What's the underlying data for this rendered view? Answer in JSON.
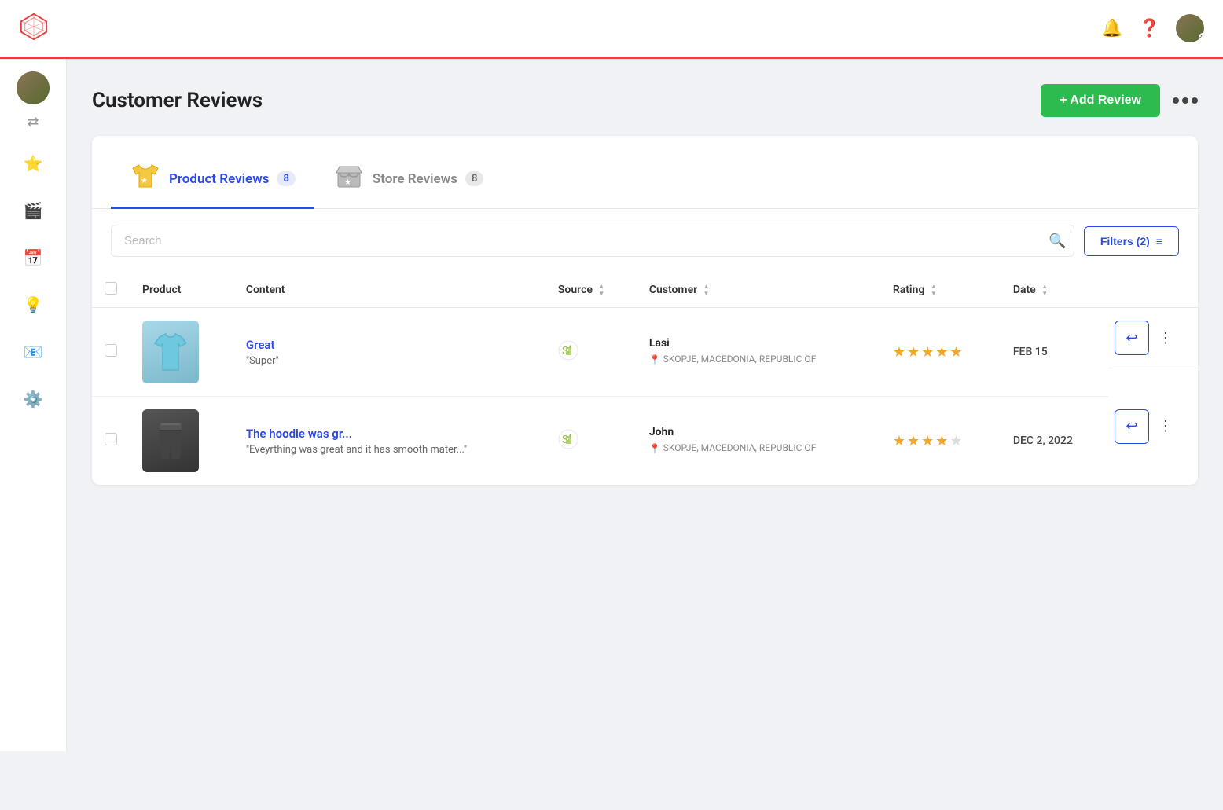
{
  "topnav": {
    "logo_alt": "App Logo"
  },
  "page": {
    "title": "Customer Reviews",
    "add_review_label": "+ Add Review"
  },
  "tabs": [
    {
      "id": "product-reviews",
      "label": "Product Reviews",
      "badge": "8",
      "active": true
    },
    {
      "id": "store-reviews",
      "label": "Store Reviews",
      "badge": "8",
      "active": false
    }
  ],
  "search": {
    "placeholder": "Search"
  },
  "filters": {
    "label": "Filters (2)"
  },
  "table": {
    "columns": [
      {
        "id": "product",
        "label": "Product",
        "sortable": false
      },
      {
        "id": "content",
        "label": "Content",
        "sortable": false
      },
      {
        "id": "source",
        "label": "Source",
        "sortable": true
      },
      {
        "id": "customer",
        "label": "Customer",
        "sortable": true
      },
      {
        "id": "rating",
        "label": "Rating",
        "sortable": true
      },
      {
        "id": "date",
        "label": "Date",
        "sortable": true
      }
    ],
    "rows": [
      {
        "id": "row-1",
        "product_type": "shirt",
        "review_title": "Great",
        "review_content": "\"Super\"",
        "source_icon": "shopify",
        "customer_name": "Lasi",
        "customer_location": "SKOPJE, MACEDONIA, REPUBLIC OF",
        "rating": 5,
        "date": "FEB 15"
      },
      {
        "id": "row-2",
        "product_type": "pants",
        "review_title": "The hoodie was gr...",
        "review_content": "\"Eveyrthing was great and it has smooth mater...\"",
        "source_icon": "shopify",
        "customer_name": "John",
        "customer_location": "SKOPJE, MACEDONIA, REPUBLIC OF",
        "rating": 4,
        "date": "DEC 2, 2022"
      }
    ]
  },
  "sidebar": {
    "items": [
      {
        "id": "reviews",
        "icon": "⭐",
        "label": "Reviews",
        "active": true
      },
      {
        "id": "media",
        "icon": "🎬",
        "label": "Media",
        "active": false
      },
      {
        "id": "calendar",
        "icon": "📅",
        "label": "Calendar",
        "active": false
      },
      {
        "id": "bulb",
        "icon": "💡",
        "label": "Insights",
        "active": false
      },
      {
        "id": "email",
        "icon": "📧",
        "label": "Email",
        "active": false
      },
      {
        "id": "settings",
        "icon": "⚙️",
        "label": "Settings",
        "active": false
      }
    ]
  }
}
